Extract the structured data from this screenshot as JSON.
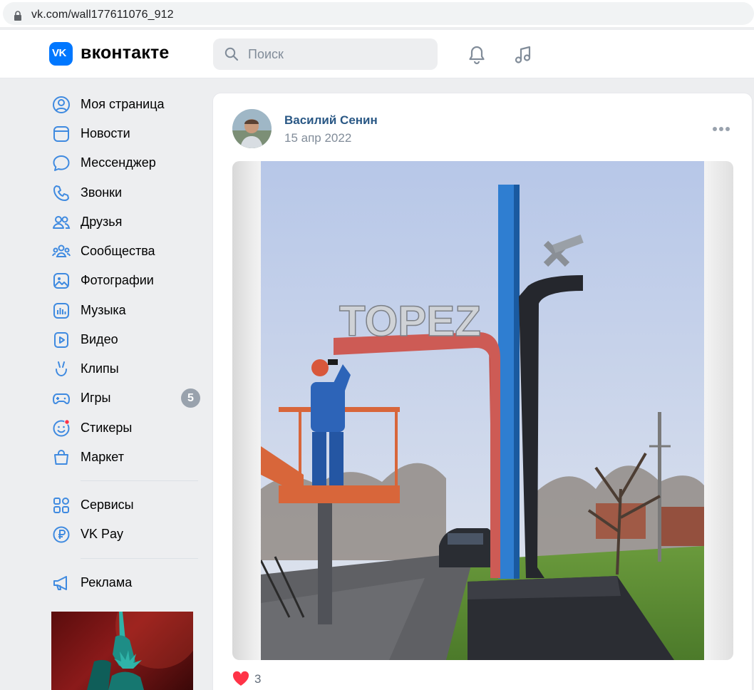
{
  "browser": {
    "url": "vk.com/wall177611076_912"
  },
  "header": {
    "logo_mark": "VK",
    "logo_text": "вконтакте",
    "search_placeholder": "Поиск",
    "icons": [
      "bell-icon",
      "music-note-icon"
    ]
  },
  "menu": {
    "items": [
      {
        "label": "Моя страница",
        "icon": "user-circle-icon"
      },
      {
        "label": "Новости",
        "icon": "newsfeed-icon"
      },
      {
        "label": "Мессенджер",
        "icon": "message-icon"
      },
      {
        "label": "Звонки",
        "icon": "phone-icon"
      },
      {
        "label": "Друзья",
        "icon": "friends-icon"
      },
      {
        "label": "Сообщества",
        "icon": "communities-icon"
      },
      {
        "label": "Фотографии",
        "icon": "photos-icon"
      },
      {
        "label": "Музыка",
        "icon": "music-icon"
      },
      {
        "label": "Видео",
        "icon": "video-icon"
      },
      {
        "label": "Клипы",
        "icon": "clips-icon"
      },
      {
        "label": "Игры",
        "icon": "games-icon",
        "badge": "5"
      },
      {
        "label": "Стикеры",
        "icon": "stickers-icon"
      },
      {
        "label": "Маркет",
        "icon": "market-icon"
      }
    ],
    "services": [
      {
        "label": "Сервисы",
        "icon": "services-icon"
      },
      {
        "label": "VK Pay",
        "icon": "vkpay-icon"
      }
    ],
    "ads": {
      "label": "Реклама",
      "icon": "megaphone-icon"
    }
  },
  "post": {
    "author": "Василий Сенин",
    "date": "15 апр 2022",
    "sign_text": "TOPEZ",
    "likes": "3"
  },
  "colors": {
    "accent": "#0077ff",
    "link": "#2a5885",
    "muted": "#818c99",
    "menu_icon": "#3f8ae0",
    "like": "#ff3347"
  }
}
